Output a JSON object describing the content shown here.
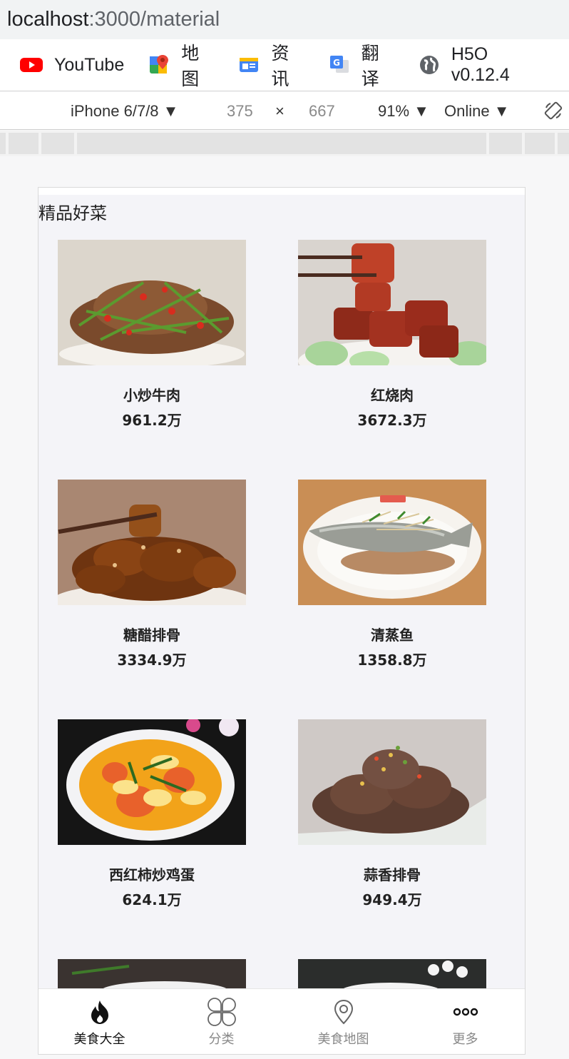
{
  "browser": {
    "url_host": "localhost",
    "url_path": ":3000/material",
    "bookmarks": [
      {
        "label": "YouTube",
        "icon": "youtube-icon"
      },
      {
        "label": "地图",
        "icon": "maps-icon"
      },
      {
        "label": "资讯",
        "icon": "news-icon"
      },
      {
        "label": "翻译",
        "icon": "translate-icon"
      },
      {
        "label": "H5O v0.12.4",
        "icon": "globe-icon"
      }
    ]
  },
  "device_toolbar": {
    "device": "iPhone 6/7/8",
    "width": "375",
    "times": "×",
    "height": "667",
    "zoom": "91%",
    "network": "Online"
  },
  "page": {
    "section_title": "精品好菜",
    "dishes": [
      {
        "name": "小炒牛肉",
        "count": "961.2万"
      },
      {
        "name": "红烧肉",
        "count": "3672.3万"
      },
      {
        "name": "糖醋排骨",
        "count": "3334.9万"
      },
      {
        "name": "清蒸鱼",
        "count": "1358.8万"
      },
      {
        "name": "西红柿炒鸡蛋",
        "count": "624.1万"
      },
      {
        "name": "蒜香排骨",
        "count": "949.4万"
      }
    ],
    "tabs": [
      {
        "label": "美食大全",
        "icon": "flame-icon",
        "active": true
      },
      {
        "label": "分类",
        "icon": "grid-icon",
        "active": false
      },
      {
        "label": "美食地图",
        "icon": "location-icon",
        "active": false
      },
      {
        "label": "更多",
        "icon": "more-icon",
        "active": false
      }
    ]
  },
  "colors": {
    "page_bg": "#f4f4f8",
    "text": "#222222",
    "tab_inactive": "#888888"
  }
}
